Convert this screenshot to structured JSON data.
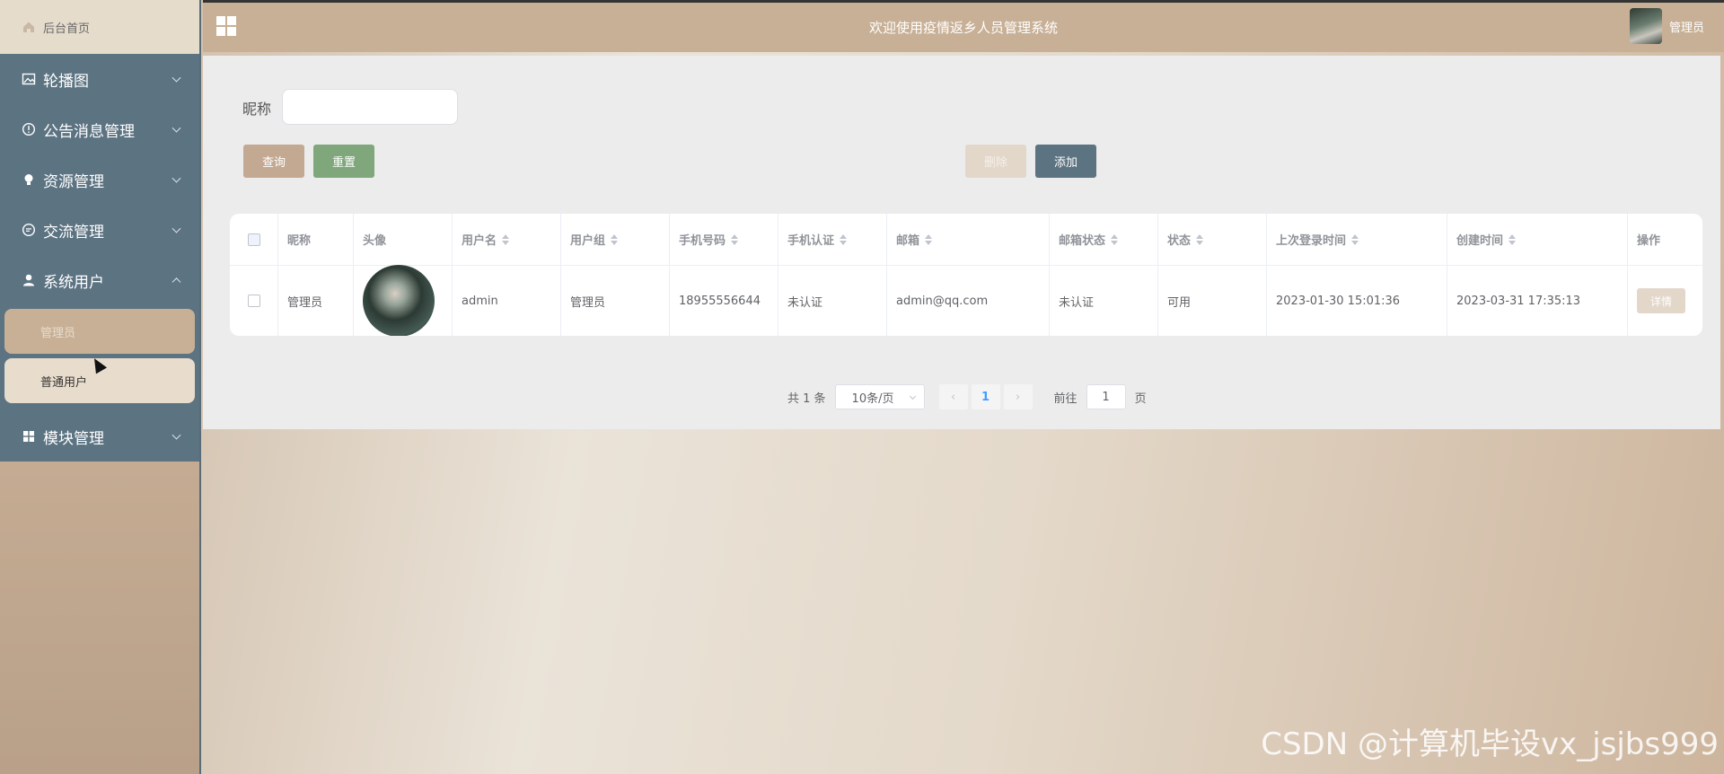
{
  "sidebar": {
    "home_label": "后台首页",
    "items": [
      {
        "label": "轮播图",
        "icon": "image-icon"
      },
      {
        "label": "公告消息管理",
        "icon": "info-circle-icon"
      },
      {
        "label": "资源管理",
        "icon": "lightbulb-icon"
      },
      {
        "label": "交流管理",
        "icon": "chat-icon"
      },
      {
        "label": "系统用户",
        "icon": "user-icon"
      },
      {
        "label": "模块管理",
        "icon": "grid-icon"
      }
    ],
    "submenu": [
      {
        "label": "管理员",
        "active": true
      },
      {
        "label": "普通用户",
        "active": false
      }
    ]
  },
  "header": {
    "title": "欢迎使用疫情返乡人员管理系统",
    "username": "管理员"
  },
  "search": {
    "label": "昵称",
    "placeholder": ""
  },
  "toolbar": {
    "query_label": "查询",
    "reset_label": "重置",
    "delete_label": "删除",
    "add_label": "添加"
  },
  "table": {
    "columns": [
      "昵称",
      "头像",
      "用户名",
      "用户组",
      "手机号码",
      "手机认证",
      "邮箱",
      "邮箱状态",
      "状态",
      "上次登录时间",
      "创建时间",
      "操作"
    ],
    "rows": [
      {
        "nickname": "管理员",
        "username": "admin",
        "group": "管理员",
        "phone": "18955556644",
        "phone_verify": "未认证",
        "email": "admin@qq.com",
        "email_status": "未认证",
        "status": "可用",
        "last_login": "2023-01-30 15:01:36",
        "created": "2023-03-31 17:35:13",
        "action_label": "详情"
      }
    ]
  },
  "pagination": {
    "total_text": "共 1 条",
    "page_size": "10条/页",
    "current_page": "1",
    "goto_prefix": "前往",
    "goto_value": "1",
    "goto_suffix": "页"
  },
  "watermark": "CSDN @计算机毕设vx_jsjbs999",
  "colors": {
    "sidebar_menu": "#5c7382",
    "header": "#c8b096",
    "query_button": "#c4a992",
    "reset_button": "#7fa77b",
    "add_button": "#5c7382"
  }
}
